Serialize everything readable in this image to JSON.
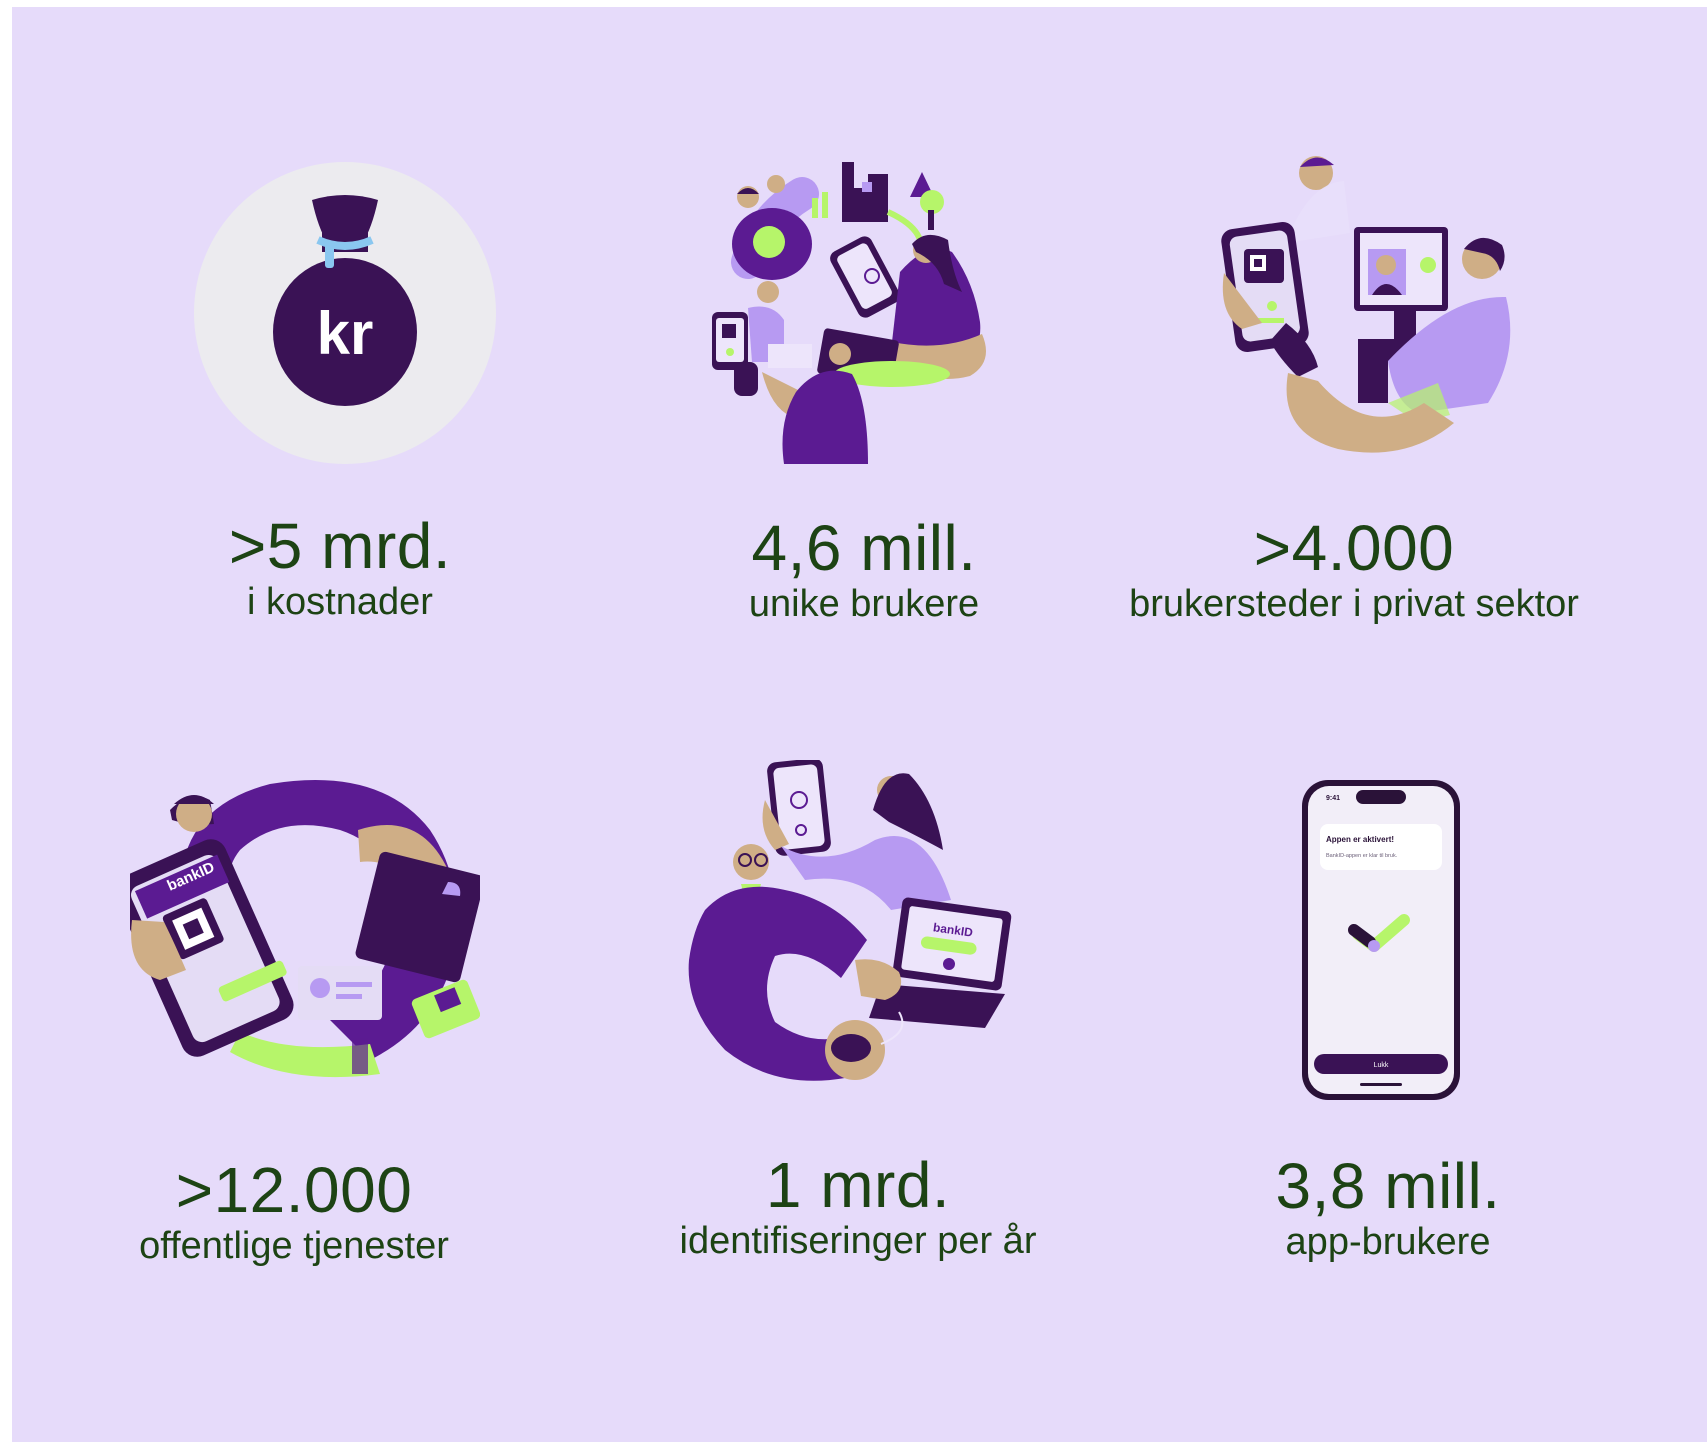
{
  "stats": [
    {
      "value": ">5 mrd.",
      "caption": "i kostnader",
      "icon": "money-bag-icon"
    },
    {
      "value": "4,6 mill.",
      "caption": "unike brukere",
      "icon": "people-network-icon"
    },
    {
      "value": ">4.000",
      "caption": "brukersteder i privat sektor",
      "icon": "phone-monitor-icon"
    },
    {
      "value": ">12.000",
      "caption": "offentlige tjenester",
      "icon": "bankid-phone-wallet-icon"
    },
    {
      "value": "1 mrd.",
      "caption": "identifiseringer per år",
      "icon": "laptop-login-icon"
    },
    {
      "value": "3,8 mill.",
      "caption": "app-brukere",
      "icon": "smartphone-app-icon"
    }
  ],
  "money_bag": {
    "symbol": "kr"
  },
  "phone_screen": {
    "time": "9:41",
    "card_title": "Appen er aktivert!",
    "card_text": "BankID-appen er klar til bruk.",
    "button_label": "Lukk"
  },
  "brand": {
    "label": "bankID"
  },
  "colors": {
    "background": "#e6dbfa",
    "text": "#1d4314",
    "purple_dark": "#3a1255",
    "purple": "#5b1b92",
    "purple_light": "#b79af2",
    "lime": "#b6f56a",
    "skin": "#cfae86"
  }
}
